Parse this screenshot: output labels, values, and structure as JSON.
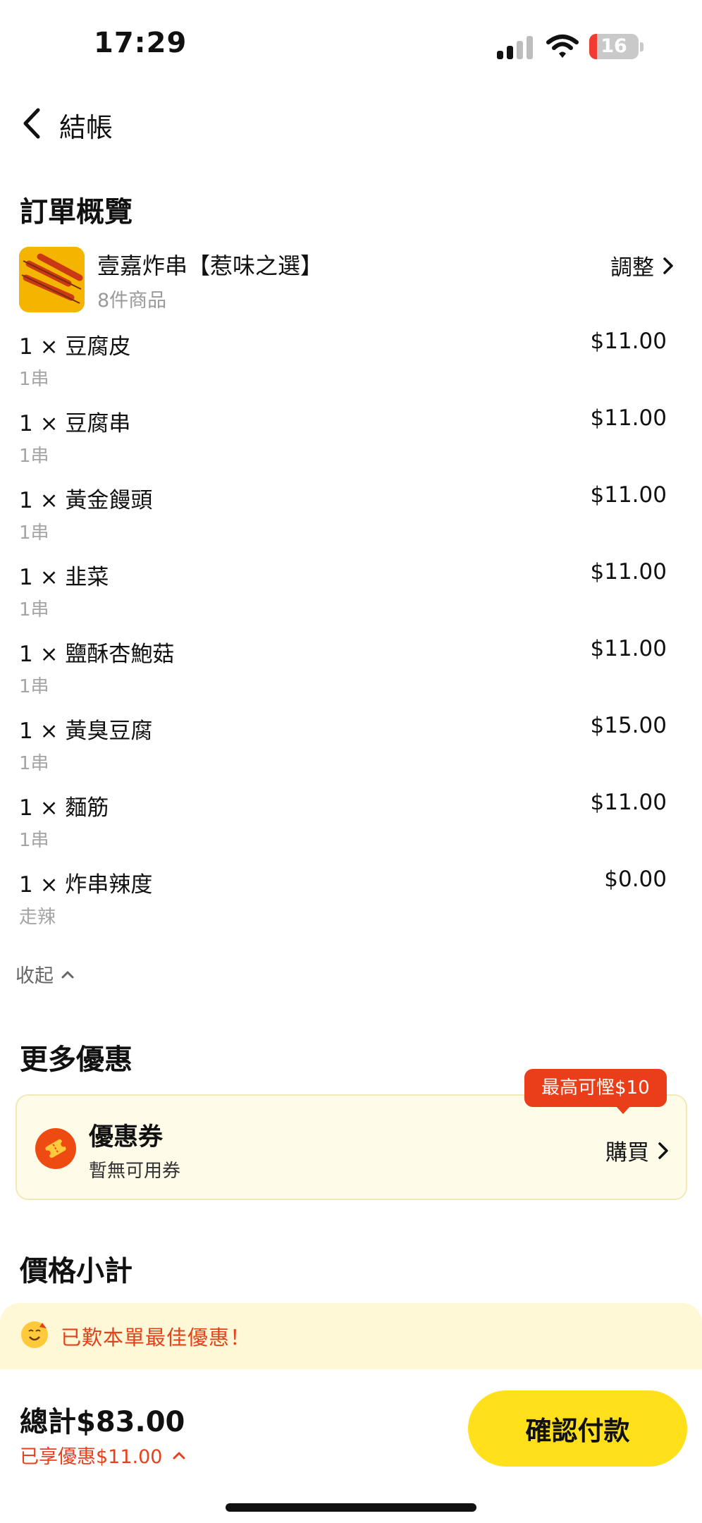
{
  "status_bar": {
    "time": "17:29",
    "battery_level": "16",
    "battery_fraction": 0.16
  },
  "nav": {
    "back_icon": "chevron-left-icon",
    "title": "結帳"
  },
  "order": {
    "section_title": "訂單概覽",
    "store": {
      "name": "壹嘉炸串【惹味之選】",
      "count": "8件商品",
      "adjust_label": "調整"
    },
    "items": [
      {
        "name": "1 × 豆腐皮",
        "note": "1串",
        "price": "$11.00"
      },
      {
        "name": "1 × 豆腐串",
        "note": "1串",
        "price": "$11.00"
      },
      {
        "name": "1 × 黃金饅頭",
        "note": "1串",
        "price": "$11.00"
      },
      {
        "name": "1 × 韭菜",
        "note": "1串",
        "price": "$11.00"
      },
      {
        "name": "1 × 鹽酥杏鮑菇",
        "note": "1串",
        "price": "$11.00"
      },
      {
        "name": "1 × 黃臭豆腐",
        "note": "1串",
        "price": "$15.00"
      },
      {
        "name": "1 × 麵筋",
        "note": "1串",
        "price": "$11.00"
      },
      {
        "name": "1 × 炸串辣度",
        "note": "走辣",
        "price": "$0.00"
      }
    ],
    "collapse_label": "收起"
  },
  "promotions": {
    "section_title": "更多優惠",
    "badge": "最高可慳$10",
    "coupon": {
      "title": "優惠券",
      "subtitle": "暫無可用券",
      "action": "購買"
    }
  },
  "pricing": {
    "section_title": "價格小計",
    "best_deal_text": "已歎本單最佳優惠！"
  },
  "footer": {
    "total": "總計$83.00",
    "saved": "已享優惠$11.00",
    "pay_button": "確認付款"
  },
  "colors": {
    "accent_yellow": "#ffe01b",
    "accent_red": "#e7401c",
    "banner_bg": "#fff8d6"
  }
}
